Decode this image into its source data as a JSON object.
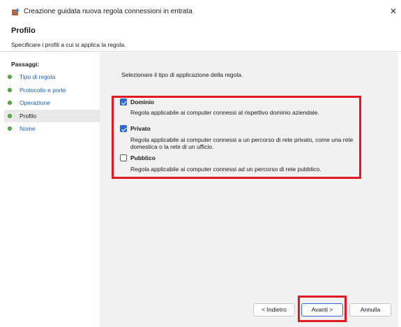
{
  "window": {
    "title": "Creazione guidata nuova regola connessioni in entrata",
    "close_glyph": "✕",
    "icon": "firewall-wizard-icon"
  },
  "header": {
    "title": "Profilo",
    "description": "Specificare i profili a cui si applica la regola."
  },
  "sidebar": {
    "title": "Passaggi:",
    "steps": [
      {
        "label": "Tipo di regola",
        "state": "completed"
      },
      {
        "label": "Protocollo e porte",
        "state": "completed"
      },
      {
        "label": "Operazione",
        "state": "completed"
      },
      {
        "label": "Profilo",
        "state": "current"
      },
      {
        "label": "Nome",
        "state": "pending"
      }
    ]
  },
  "main": {
    "instruction": "Selezionare il tipo di applicazione della regola.",
    "options": [
      {
        "label": "Dominio",
        "checked": true,
        "description": [
          "Regola applicabile ai computer connessi al rispettivo dominio aziendale."
        ]
      },
      {
        "label": "Privato",
        "checked": true,
        "description": [
          "Regola applicabile ai computer connessi a un percorso di rete privato, come una rete",
          "domestica o la rete di un ufficio."
        ]
      },
      {
        "label": "Pubblico",
        "checked": false,
        "description": [
          "Regola applicabile ai computer connessi ad un percorso di rete pubblico."
        ]
      }
    ]
  },
  "footer": {
    "back_label": "< Indietro",
    "next_label": "Avanti >",
    "cancel_label": "Annulla"
  },
  "colors": {
    "highlight": "#e01922",
    "checkbox": "#2f6bd1",
    "step_dot": "#5ab040",
    "link": "#1a5fb4"
  }
}
